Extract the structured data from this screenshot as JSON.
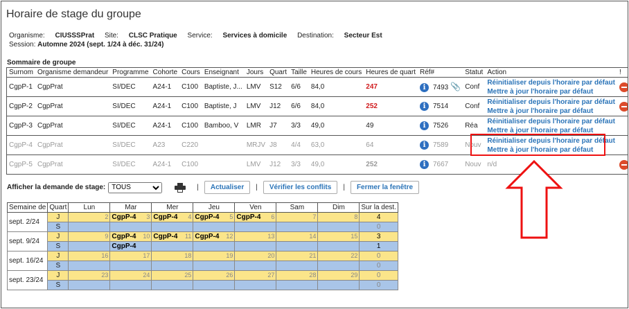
{
  "title": "Horaire de stage du groupe",
  "meta": {
    "org_label": "Organisme:",
    "org": "CIUSSSPrat",
    "site_label": "Site:",
    "site": "CLSC Pratique",
    "service_label": "Service:",
    "service": "Services à domicile",
    "dest_label": "Destination:",
    "dest": "Secteur Est",
    "session_label": "Session:",
    "session": "Automne 2024 (sept. 1/24 à déc. 31/24)"
  },
  "summary_title": "Sommaire de groupe",
  "headers": [
    "Surnom",
    "Organisme demandeur",
    "Programme",
    "Cohorte",
    "Cours",
    "Enseignant",
    "Jours",
    "Quart",
    "Taille",
    "Heures de cours",
    "Heures de quart",
    "Réf#",
    "Statut",
    "Action",
    "!"
  ],
  "rows": [
    {
      "surnom": "CgpP-1",
      "org": "CgpPrat",
      "prog": "SI/DEC",
      "coh": "A24-1",
      "cours": "C100",
      "ens": "Baptiste, J...",
      "jours": "LMV",
      "quart": "S12",
      "taille": "6/6",
      "hc": "84,0",
      "hq": "247",
      "ref": "7493",
      "statut": "Conf",
      "a1": "Réinitialiser depuis l'horaire par défaut",
      "a2": "Mettre à jour l'horaire par défaut"
    },
    {
      "surnom": "CgpP-2",
      "org": "CgpPrat",
      "prog": "SI/DEC",
      "coh": "A24-1",
      "cours": "C100",
      "ens": "Baptiste, J",
      "jours": "LMV",
      "quart": "J12",
      "taille": "6/6",
      "hc": "84,0",
      "hq": "252",
      "ref": "7514",
      "statut": "Conf",
      "a1": "Réinitialiser depuis l'horaire par défaut",
      "a2": "Mettre à jour l'horaire par défaut"
    },
    {
      "surnom": "CgpP-3",
      "org": "CgpPrat",
      "prog": "SI/DEC",
      "coh": "A24-1",
      "cours": "C100",
      "ens": "Bamboo, V",
      "jours": "LMR",
      "quart": "J7",
      "taille": "3/3",
      "hc": "49,0",
      "hq": "49",
      "ref": "7526",
      "statut": "Réa",
      "a1": "Réinitialiser depuis l'horaire par défaut",
      "a2": "Mettre à jour l'horaire par défaut"
    },
    {
      "surnom": "CgpP-4",
      "org": "CgpPrat",
      "prog": "SI/DEC",
      "coh": "A23",
      "cours": "C220",
      "ens": "",
      "jours": "MRJV",
      "quart": "J8",
      "taille": "4/4",
      "hc": "63,0",
      "hq": "64",
      "ref": "7589",
      "statut": "Nouv",
      "a1": "Réinitialiser depuis l'horaire par défaut",
      "a2": "Mettre à jour l'horaire par défaut"
    },
    {
      "surnom": "CgpP-5",
      "org": "CgpPrat",
      "prog": "SI/DEC",
      "coh": "A24-1",
      "cours": "C100",
      "ens": "",
      "jours": "LMV",
      "quart": "J12",
      "taille": "3/3",
      "hc": "49,0",
      "hq": "252",
      "ref": "7667",
      "statut": "Nouv",
      "a1": "n/d",
      "a2": ""
    }
  ],
  "filter": {
    "label": "Afficher la demande de stage:",
    "value": "TOUS",
    "btn_refresh": "Actualiser",
    "btn_check": "Vérifier les conflits",
    "btn_close": "Fermer la fenêtre"
  },
  "calendar": {
    "headers": [
      "Semaine de",
      "Quart",
      "Lun",
      "Mar",
      "Mer",
      "Jeu",
      "Ven",
      "Sam",
      "Dim",
      "Sur la dest."
    ],
    "weeks": [
      {
        "label": "sept. 2/24",
        "j": [
          "2",
          "3",
          "4",
          "5",
          "6",
          "7",
          "8"
        ],
        "j_ev": [
          "",
          "CgpP-4",
          "CgpP-4",
          "CgpP-4",
          "CgpP-4",
          "",
          ""
        ],
        "j_tot": "4",
        "s_ev": [
          "",
          "",
          "",
          "",
          "",
          "",
          ""
        ],
        "s_tot": "0"
      },
      {
        "label": "sept. 9/24",
        "j": [
          "9",
          "10",
          "11",
          "12",
          "13",
          "14",
          "15"
        ],
        "j_ev": [
          "",
          "CgpP-4",
          "CgpP-4",
          "CgpP-4",
          "",
          "",
          ""
        ],
        "j_tot": "3",
        "s_ev": [
          "",
          "CgpP-4",
          "",
          "",
          "",
          "",
          ""
        ],
        "s_tot": "1"
      },
      {
        "label": "sept. 16/24",
        "j": [
          "16",
          "17",
          "18",
          "19",
          "20",
          "21",
          "22"
        ],
        "j_ev": [
          "",
          "",
          "",
          "",
          "",
          "",
          ""
        ],
        "j_tot": "0",
        "s_ev": [
          "",
          "",
          "",
          "",
          "",
          "",
          ""
        ],
        "s_tot": "0"
      },
      {
        "label": "sept. 23/24",
        "j": [
          "23",
          "24",
          "25",
          "26",
          "27",
          "28",
          "29"
        ],
        "j_ev": [
          "",
          "",
          "",
          "",
          "",
          "",
          ""
        ],
        "j_tot": "0",
        "s_ev": [
          "",
          "",
          "",
          "",
          "",
          "",
          ""
        ],
        "s_tot": "0"
      }
    ],
    "quart_j": "J",
    "quart_s": "S"
  },
  "colors": {
    "accent": "#2b74b8",
    "alert": "#d0191b",
    "day": "#fbe58a",
    "night": "#a9c5e8"
  }
}
